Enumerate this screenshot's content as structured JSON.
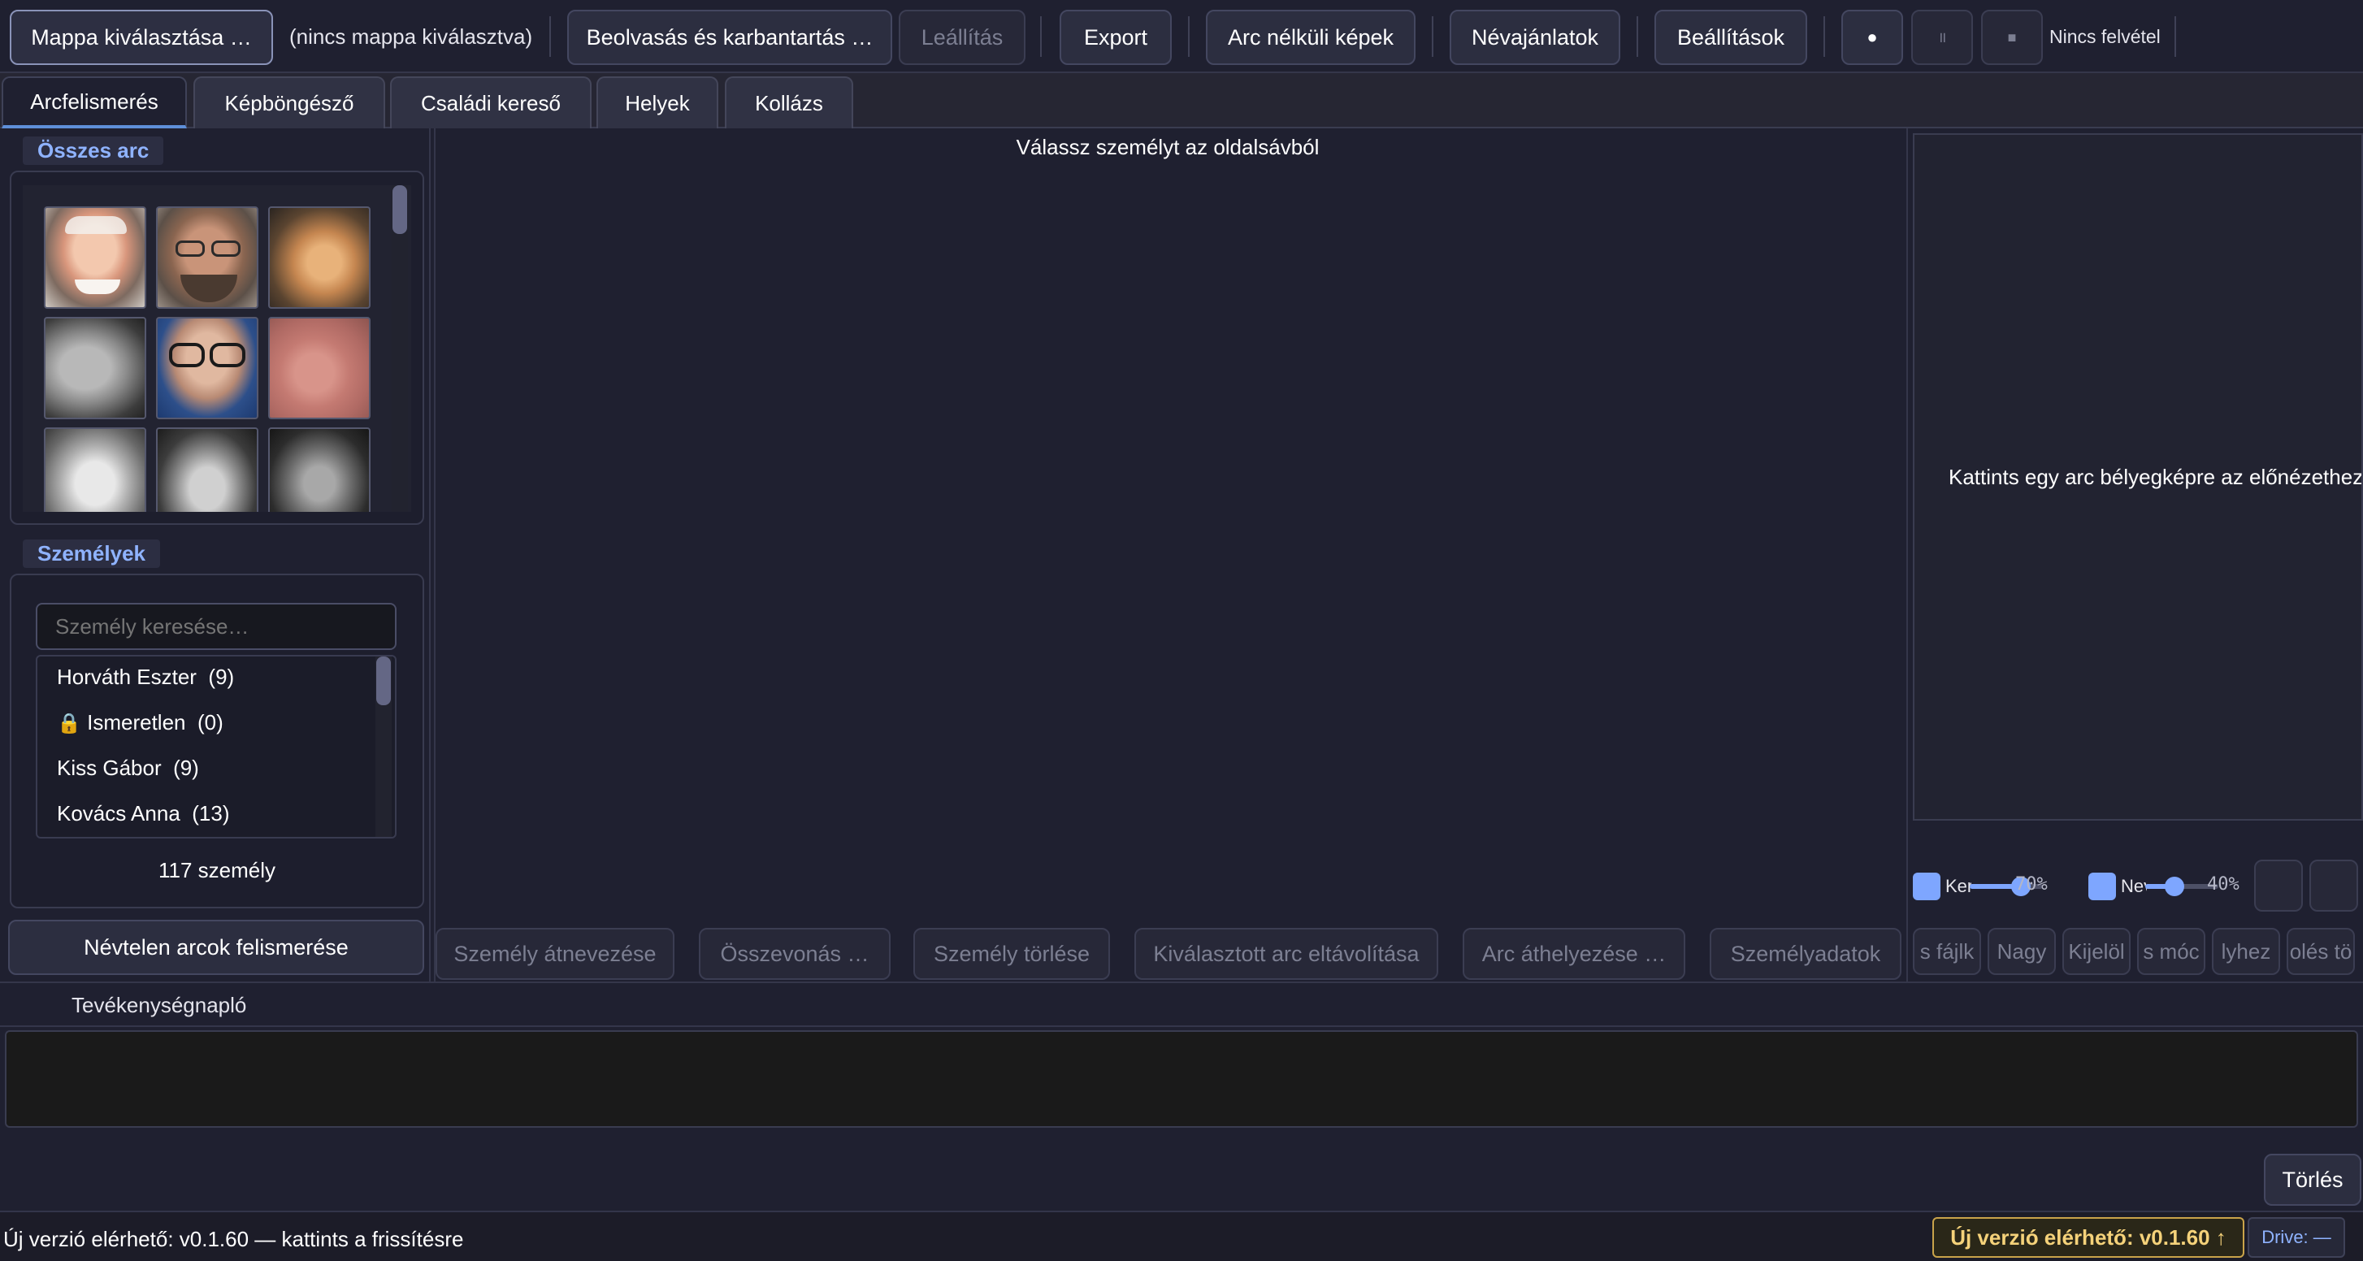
{
  "toolbar": {
    "choose_folder": "Mappa kiválasztása …",
    "folder_status": "(nincs mappa kiválasztva)",
    "scan_maintain": "Beolvasás és karbantartás …",
    "stop": "Leállítás",
    "export": "Export",
    "faceless_images": "Arc nélküli képek",
    "name_suggestions": "Névajánlatok",
    "settings": "Beállítások",
    "record_glyph": "●",
    "pause_glyph": "॥",
    "stop_glyph": "■",
    "recording_status": "Nincs felvétel"
  },
  "tabs": [
    {
      "label": "Arcfelismerés",
      "active": true
    },
    {
      "label": "Képböngésző",
      "active": false
    },
    {
      "label": "Családi kereső",
      "active": false
    },
    {
      "label": "Helyek",
      "active": false
    },
    {
      "label": "Kollázs",
      "active": false
    }
  ],
  "sidebar": {
    "all_faces_title": "Összes arc",
    "people_title": "Személyek",
    "search_placeholder": "Személy keresése…",
    "people": [
      {
        "name": "Horváth Eszter",
        "count": "(9)",
        "locked": false
      },
      {
        "name": "Ismeretlen",
        "count": "(0)",
        "locked": true
      },
      {
        "name": "Kiss Gábor",
        "count": "(9)",
        "locked": false
      },
      {
        "name": "Kovács Anna",
        "count": "(13)",
        "locked": false
      }
    ],
    "people_count": "117 személy",
    "recognize_unnamed": "Névtelen arcok felismerése",
    "lock_glyph": "🔒"
  },
  "main": {
    "hint": "Válassz személyt az oldalsávból",
    "actions": {
      "rename": "Személy átnevezése",
      "merge": "Összevonás …",
      "delete": "Személy törlése",
      "remove_face": "Kiválasztott arc eltávolítása",
      "move_face": "Arc áthelyezése …",
      "person_data": "Személyadatok"
    }
  },
  "preview": {
    "hint": "Kattints egy arc bélyegképre az előnézethez",
    "slider1": {
      "label": "Ker",
      "value_text": "70%",
      "value": 0.7
    },
    "slider2": {
      "label": "Nev",
      "value_text": "40%",
      "value": 0.4
    },
    "buttons": [
      "s fájlk",
      "Nagy",
      "Kijelöl",
      "s móc",
      "lyhez",
      "olés tö"
    ]
  },
  "log": {
    "title": "Tevékenységnapló",
    "clear": "Törlés"
  },
  "status": {
    "message": "Új verzió elérhető: v0.1.60 — kattints a frissítésre",
    "update_badge": "Új verzió elérhető: v0.1.60 ↑",
    "drive": "Drive: —"
  },
  "colors": {
    "background": "#1f2030",
    "accent": "#8fb3ff",
    "update_badge_text": "#f5d27a",
    "update_badge_border": "#c9a34a"
  }
}
